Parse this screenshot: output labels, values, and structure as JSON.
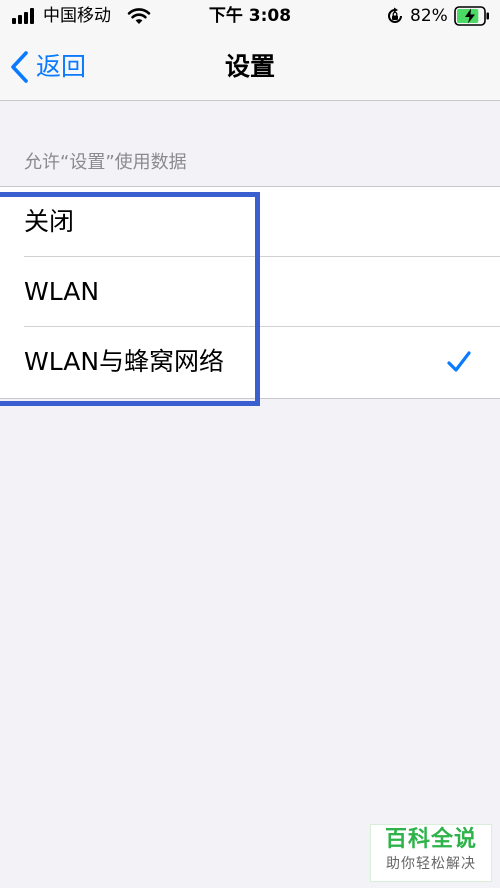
{
  "status_bar": {
    "carrier": "中国移动",
    "time": "下午 3:08",
    "battery_percent": "82%",
    "battery_level": 0.82,
    "charging": true,
    "icons": [
      "signal-icon",
      "wifi-icon",
      "rotation-lock-icon",
      "battery-icon"
    ]
  },
  "nav": {
    "back_label": "返回",
    "title": "设置"
  },
  "section": {
    "header": "允许“设置”使用数据",
    "options": [
      {
        "label": "关闭",
        "selected": false
      },
      {
        "label": "WLAN",
        "selected": false
      },
      {
        "label": "WLAN与蜂窝网络",
        "selected": true
      }
    ]
  },
  "watermark": {
    "title": "百科全说",
    "subtitle": "助你轻松解决"
  },
  "colors": {
    "accent": "#0a7aff",
    "highlight_box": "#3a5fcf",
    "background": "#f2f2f7",
    "watermark_green": "#2db34a"
  }
}
